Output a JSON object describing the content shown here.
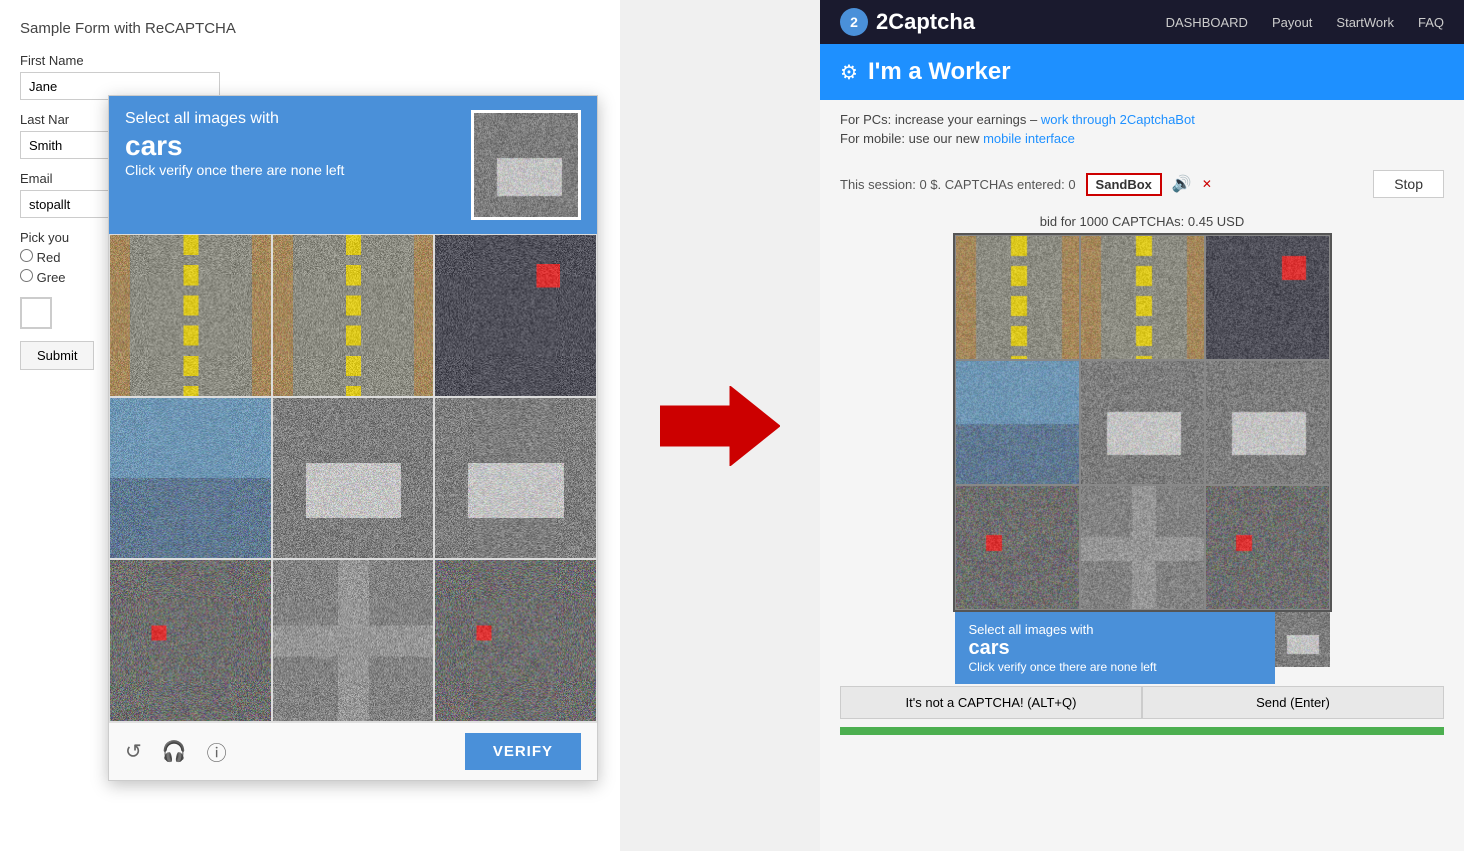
{
  "left": {
    "form_title": "Sample Form with ReCAPTCHA",
    "first_name_label": "First Name",
    "first_name_value": "Jane",
    "last_name_label": "Last Nar",
    "last_name_value": "Smith",
    "email_label": "Email",
    "email_placeholder": "stopallt",
    "pick_label": "Pick you",
    "radio_red": "Red",
    "radio_green": "Gree",
    "submit_label": "Submit"
  },
  "captcha": {
    "header_select": "Select all images with",
    "header_object": "cars",
    "header_verify": "Click verify once there are none left",
    "verify_btn": "VERIFY",
    "icon_refresh": "↺",
    "icon_audio": "🎧",
    "icon_info": "ℹ"
  },
  "right": {
    "logo": "2Captcha",
    "nav": [
      "DASHBOARD",
      "Payout",
      "StartWork",
      "FAQ"
    ],
    "worker_title": "I'm a Worker",
    "for_pcs_text": "For PCs: increase your earnings –",
    "for_pcs_link": "work through 2CaptchaBot",
    "for_mobile_text": "For mobile: use our new",
    "for_mobile_link": "mobile interface",
    "session_text": "This session: 0 $. CAPTCHAs entered: 0",
    "sandbox_label": "SandBox",
    "stop_label": "Stop",
    "bid_text": "bid for 1000 CAPTCHAs: 0.45 USD",
    "not_captcha_label": "It's not a CAPTCHA! (ALT+Q)",
    "send_label": "Send (Enter)"
  }
}
